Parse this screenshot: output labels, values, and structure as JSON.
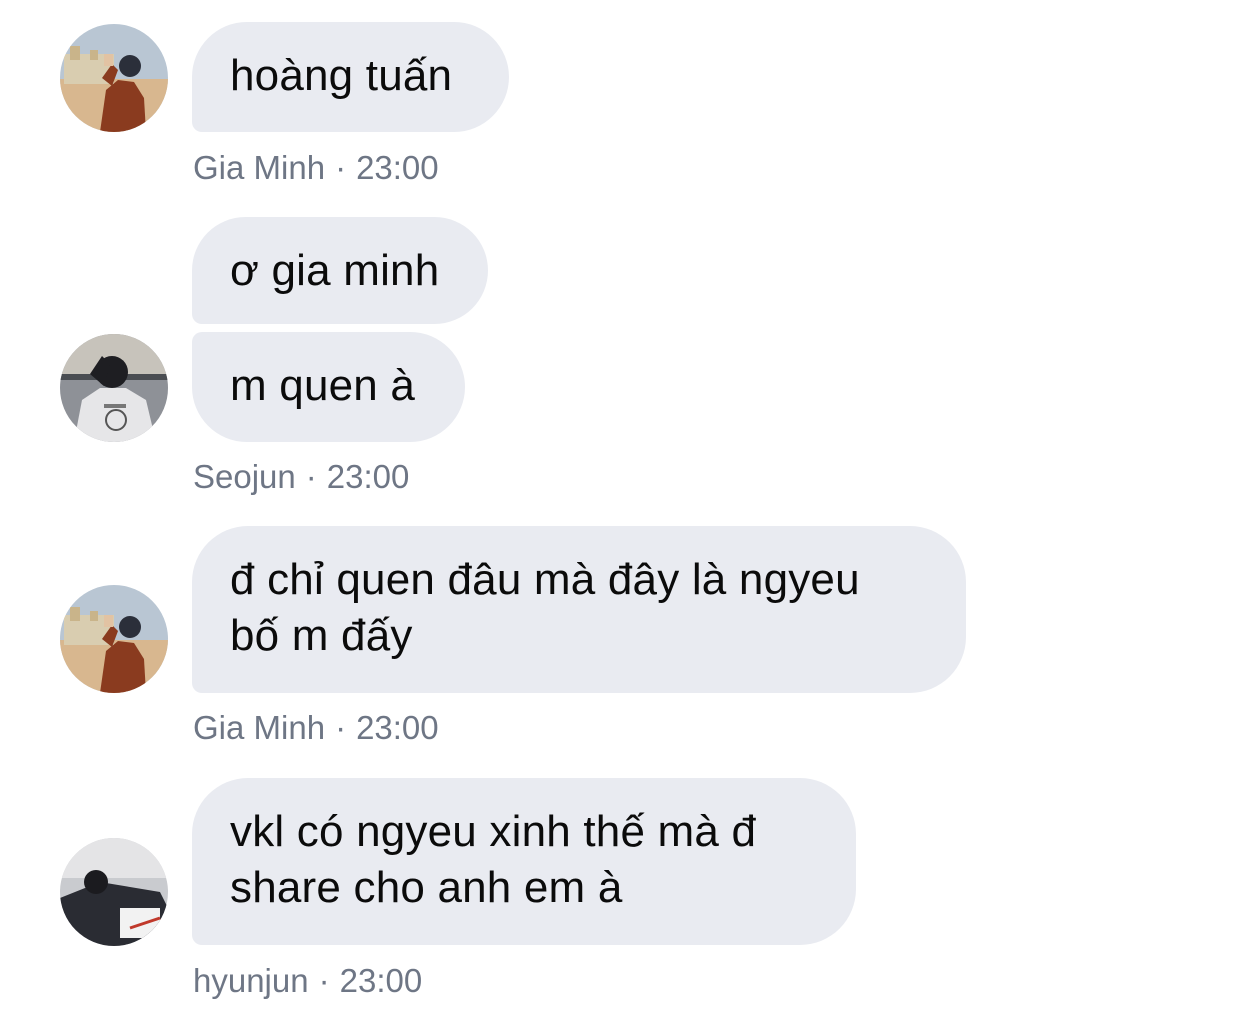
{
  "messages": [
    {
      "author": "Gia Minh",
      "time": "23:00",
      "avatar": "photo-man-orange-jacket-avatar",
      "bubbles": [
        "hoàng tuấn"
      ]
    },
    {
      "author": "Seojun",
      "time": "23:00",
      "avatar": "photo-man-hoodie-avatar",
      "bubbles": [
        "ơ gia minh",
        "m quen à"
      ]
    },
    {
      "author": "Gia Minh",
      "time": "23:00",
      "avatar": "photo-man-orange-jacket-avatar",
      "bubbles": [
        "đ chỉ quen đâu mà đây là ngyeu\nbố m đấy"
      ]
    },
    {
      "author": "hyunjun",
      "time": "23:00",
      "avatar": "photo-man-lying-avatar",
      "bubbles": [
        "vkl có ngyeu xinh thế mà đ\nshare cho anh em à"
      ]
    }
  ],
  "meta_separator": "·",
  "colors": {
    "bubble_bg": "#e9ebf1",
    "meta_text": "#6e7685",
    "message_text": "#0b0b0b"
  }
}
